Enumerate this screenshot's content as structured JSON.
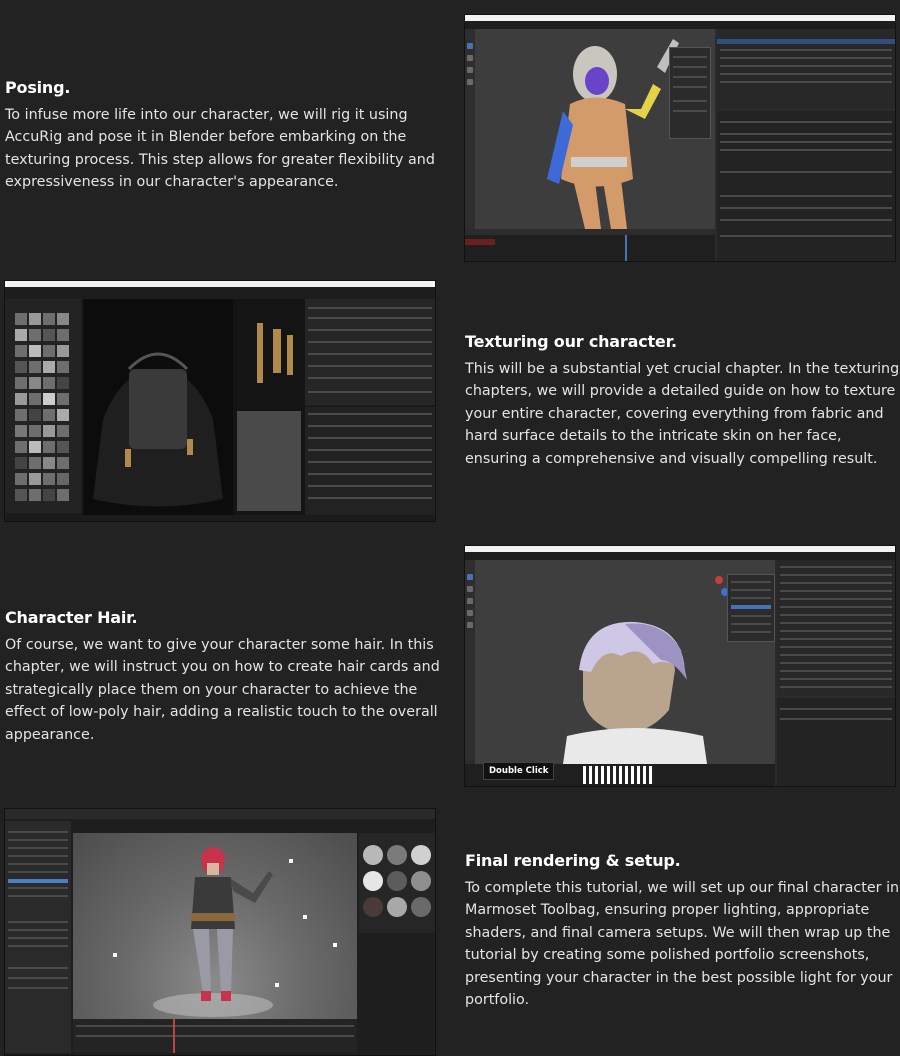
{
  "sections": [
    {
      "title": "Posing.",
      "body": "To infuse more life into our character, we will rig it using AccuRig and pose it in Blender before embarking on the texturing process. This step allows for greater flexibility and expressiveness in our character's appearance."
    },
    {
      "title": "Texturing our character.",
      "body": "This will be a substantial yet crucial chapter. In the texturing chapters, we will provide a detailed guide on how to texture your entire character, covering everything from fabric and hard surface details to the intricate skin on her face, ensuring a comprehensive and visually compelling result."
    },
    {
      "title": "Character Hair.",
      "body": "Of course, we want to give your character some hair. In this chapter, we will instruct you on how to create hair cards and strategically place them on your character to achieve the effect of low-poly hair, adding a realistic touch to the overall appearance."
    },
    {
      "title": "Final rendering & setup.",
      "body": "To complete this tutorial, we will set up our final character in Marmoset Toolbag, ensuring proper lighting, appropriate shaders, and final camera setups. We will then wrap up the tutorial by creating some polished portfolio screenshots, presenting your character in the best possible light for your portfolio."
    }
  ],
  "screenshots": {
    "hair_overlay_label": "Double Click"
  },
  "colors": {
    "page_background": "#222222",
    "heading": "#ffffff",
    "body_text": "#e4e4e4",
    "blender_accent": "#4772b3"
  }
}
